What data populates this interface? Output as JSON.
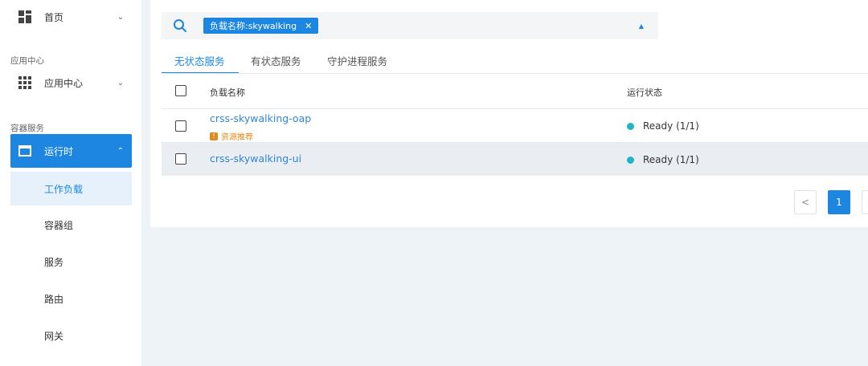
{
  "sidebar": {
    "home": {
      "label": "首页",
      "icon": "dashboard-icon"
    },
    "section_app": "应用中心",
    "app_center": {
      "label": "应用中心",
      "icon": "grid-icon"
    },
    "section_container": "容器服务",
    "runtime": {
      "label": "运行时",
      "icon": "window-icon"
    },
    "sub_items": [
      {
        "label": "工作负载"
      },
      {
        "label": "容器组"
      },
      {
        "label": "服务"
      },
      {
        "label": "路由"
      },
      {
        "label": "网关"
      }
    ]
  },
  "search": {
    "tag_label": "负载名称:skywalking"
  },
  "tabs": [
    {
      "label": "无状态服务"
    },
    {
      "label": "有状态服务"
    },
    {
      "label": "守护进程服务"
    }
  ],
  "table": {
    "columns": {
      "name": "负载名称",
      "status": "运行状态"
    },
    "rows": [
      {
        "name": "crss-skywalking-oap",
        "recommend": "资源推荐",
        "status": "Ready (1/1)"
      },
      {
        "name": "crss-skywalking-ui",
        "status": "Ready (1/1)"
      }
    ]
  },
  "pagination": {
    "prev": "<",
    "current": "1"
  },
  "colors": {
    "accent": "#1c86e0",
    "status_ready": "#1fb5c9",
    "recommend": "#e08a1c"
  }
}
